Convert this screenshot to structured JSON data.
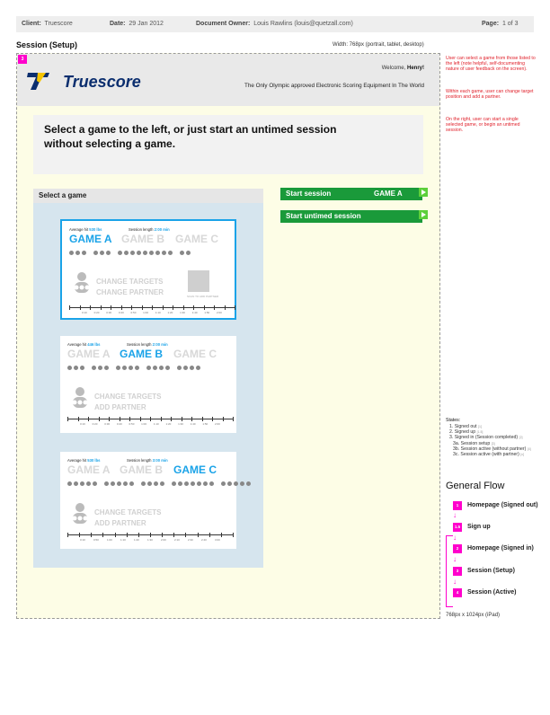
{
  "doc_header": {
    "client_label": "Client:",
    "client_value": "Truescore",
    "date_label": "Date:",
    "date_value": "29 Jan 2012",
    "owner_label": "Document Owner:",
    "owner_value": "Louis Rawlins (louis@quetzall.com)",
    "page_label": "Page:",
    "page_value": "1 of 3"
  },
  "page_title": "Session (Setup)",
  "width_note": "Width: 768px (portrait, tablet, desktop)",
  "frame_number": "3",
  "site": {
    "logo_text": "Truescore",
    "welcome_prefix": "Welcome, ",
    "welcome_name": "Henry!",
    "tagline": "The Only Olympic approved Electronic Scoring Equipment In The World"
  },
  "prompt": "Select a game to the left, or just start an untimed session without selecting a game.",
  "games_heading": "Select a game",
  "buttons": {
    "start_session": "Start session",
    "start_session_game": "GAME A",
    "start_untimed": "Start untimed session"
  },
  "cards": [
    {
      "avg_hit_label": "Average hit",
      "avg_hit_value": "530 lbs",
      "session_length_label": "Session length",
      "session_length_value": "2:00 min",
      "games": [
        "GAME A",
        "GAME B",
        "GAME C"
      ],
      "active": 0,
      "action1": "CHANGE TARGETS",
      "action2": "CHANGE PARTNER",
      "qr_label": "SCAN TO ADD PARTNER",
      "dot_groups": [
        3,
        3,
        9,
        2
      ],
      "ticks": 16,
      "tick_labels": [
        "0:10",
        "0:20",
        "0:30",
        "0:40",
        "0:50",
        "1:00",
        "1:10",
        "1:20",
        "1:30",
        "1:40",
        "1:50",
        "2:00"
      ]
    },
    {
      "avg_hit_label": "Average hit",
      "avg_hit_value": "446 lbs",
      "session_length_label": "Session length",
      "session_length_value": "2:00 min",
      "games": [
        "GAME A",
        "GAME B",
        "GAME C"
      ],
      "active": 1,
      "action1": "CHANGE TARGETS",
      "action2": "ADD PARTNER",
      "dot_groups": [
        3,
        3,
        4,
        4,
        4
      ],
      "ticks": 16,
      "tick_labels": [
        "0:10",
        "0:20",
        "0:30",
        "0:40",
        "0:50",
        "1:00",
        "1:10",
        "1:20",
        "1:30",
        "1:40",
        "1:50",
        "2:00"
      ]
    },
    {
      "avg_hit_label": "Average hit",
      "avg_hit_value": "530 lbs",
      "session_length_label": "Session length",
      "session_length_value": "3:00 min",
      "games": [
        "GAME A",
        "GAME B",
        "GAME C"
      ],
      "active": 2,
      "action1": "CHANGE TARGETS",
      "action2": "ADD PARTNER",
      "dot_groups": [
        5,
        5,
        4,
        7,
        5
      ],
      "ticks": 14,
      "tick_labels": [
        "0:10",
        "0:50",
        "1:00",
        "1:10",
        "1:20",
        "1:30",
        "2:00",
        "2:10",
        "2:30",
        "2:40",
        "3:00"
      ]
    }
  ],
  "notes": [
    "User can select a game from those listed to the left (note helpful, self-documenting nature of user feedback on the screen).",
    "Within each game, user can change target position and add a partner.",
    "On the right, user can start a single selected game, or begin an untimed session."
  ],
  "states_title": "States:",
  "states": [
    {
      "text": "1. Signed out",
      "ref": "[1]"
    },
    {
      "text": "2. Signed up",
      "ref": "[1.5]"
    },
    {
      "text": "3. Signed in (Session completed)",
      "ref": "[2]"
    },
    {
      "text": "3a. Session setup",
      "ref": "[3]"
    },
    {
      "text": "3b. Session active (without partner)",
      "ref": "[4]"
    },
    {
      "text": "3c. Session active (with partner)",
      "ref": "[x]"
    }
  ],
  "flow_title": "General Flow",
  "flow": [
    {
      "badge": "1",
      "label": "Homepage (Signed out)"
    },
    {
      "badge": "1.5",
      "label": "Sign up"
    },
    {
      "badge": "2",
      "label": "Homepage (Signed in)"
    },
    {
      "badge": "3",
      "label": "Session (Setup)"
    },
    {
      "badge": "4",
      "label": "Session (Active)"
    }
  ],
  "footnote": "768px x 1024px (iPad)",
  "colors": {
    "accent_blue": "#1aa3e8",
    "start_green": "#1a9a3a",
    "flow_magenta": "#ff00cc",
    "note_red": "#e0202a",
    "logo_navy": "#0b2e6e"
  }
}
